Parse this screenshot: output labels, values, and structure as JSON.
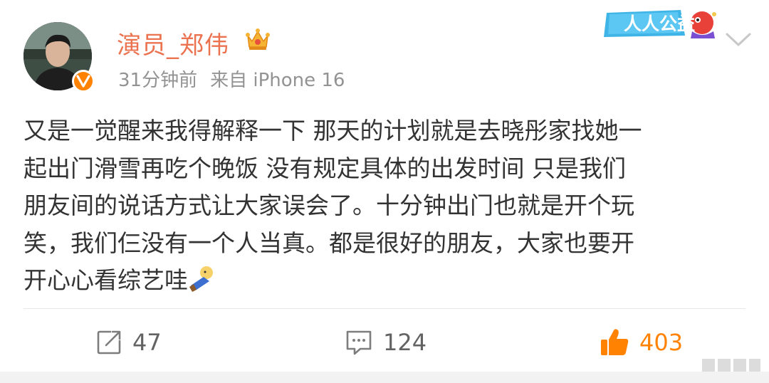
{
  "post": {
    "author": {
      "name": "演员_郑伟",
      "avatar": "avatar",
      "verified_icon": "verified-v-icon",
      "member_icon": "crown-icon"
    },
    "time": "31分钟前",
    "source": "来自 iPhone 16",
    "badge_text": "人人公益",
    "content_lines": [
      "又是一觉醒来我得解释一下 那天的计划就是去晓彤家找她一",
      "起出门滑雪再吃个晚饭 没有规定具体的出发时间 只是我们",
      "朋友间的说话方式让大家误会了。十分钟出门也就是开个玩",
      "笑，我们仨没有一个人当真。都是很好的朋友，大家也要开",
      "开心心看综艺哇"
    ],
    "actions": {
      "repost": {
        "count": "47",
        "icon": "repost-icon"
      },
      "comment": {
        "count": "124",
        "icon": "comment-icon"
      },
      "like": {
        "count": "403",
        "icon": "thumbs-up-icon"
      }
    }
  },
  "colors": {
    "username": "#eb7350",
    "meta": "#939393",
    "text": "#333333",
    "action": "#636363",
    "like": "#ff8200",
    "verified": "#ff8200"
  }
}
